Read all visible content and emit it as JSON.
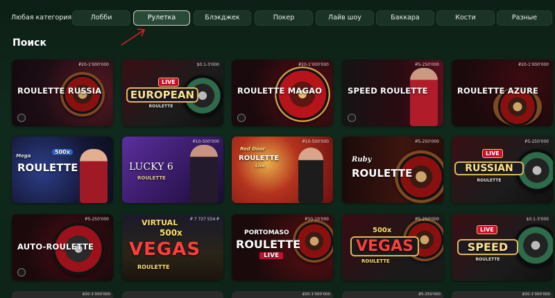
{
  "categories": [
    {
      "label": "Любая категория",
      "state": "plain"
    },
    {
      "label": "Лобби",
      "state": "normal"
    },
    {
      "label": "Рулетка",
      "state": "active"
    },
    {
      "label": "Блэкджек",
      "state": "normal"
    },
    {
      "label": "Покер",
      "state": "normal"
    },
    {
      "label": "Лайв шоу",
      "state": "normal"
    },
    {
      "label": "Баккара",
      "state": "normal"
    },
    {
      "label": "Кости",
      "state": "normal"
    },
    {
      "label": "Разные",
      "state": "normal"
    }
  ],
  "section_title": "Поиск",
  "games": [
    {
      "title": "ROULETTE RUSSIA",
      "limit": "₽20-1'000'000"
    },
    {
      "title": "EUROPEAN",
      "sub": "ROULETTE",
      "live": "LIVE",
      "limit": "$0.1-3'000"
    },
    {
      "title": "ROULETTE MAGAO",
      "limit": "₽20-1'000'000"
    },
    {
      "title": "SPEED ROULETTE",
      "limit": "₽5-250'000"
    },
    {
      "title": "ROULETTE AZURE",
      "limit": "₽20-1'000'000"
    },
    {
      "title": "ROULETTE",
      "pre": "Mega",
      "multi": "500x",
      "limit": ""
    },
    {
      "title": "LUCKY 6",
      "sub": "ROULETTE",
      "limit": "₽10-500'000"
    },
    {
      "title": "ROULETTE",
      "pre": "Red Door",
      "sub": "Live",
      "limit": "₽10-500'000"
    },
    {
      "title": "ROULETTE",
      "pre": "Ruby",
      "limit": "₽5-250'000"
    },
    {
      "title": "RUSSIAN",
      "sub": "ROULETTE",
      "live": "LIVE",
      "limit": "₽5-250'000"
    },
    {
      "title": "AUTO-ROULETTE",
      "limit": "₽5-250'000"
    },
    {
      "title": "VEGAS",
      "pre": "VIRTUAL",
      "multi": "500x",
      "sub": "ROULETTE",
      "limit": "₽ 7 727 554 ₽"
    },
    {
      "title": "ROULETTE",
      "pre": "PORTOMASO",
      "sub": "LIVE",
      "limit": "₽10-10'000"
    },
    {
      "title": "VEGAS",
      "multi": "500x",
      "sub": "ROULETTE",
      "limit": "₽5-250'000"
    },
    {
      "title": "SPEED",
      "sub": "ROULETTE",
      "live": "LIVE",
      "limit": "$0.1-3'000"
    }
  ],
  "bottom_limits": [
    "₽20-1'000'000",
    "",
    "₽20-1'000'000",
    "₽5-250'000",
    "₽20-1'000'000"
  ],
  "colors": {
    "accent_active": "#2a4a38",
    "background": "#0f2a1c",
    "live_red": "#c8102e",
    "arrow": "#e0201f"
  }
}
